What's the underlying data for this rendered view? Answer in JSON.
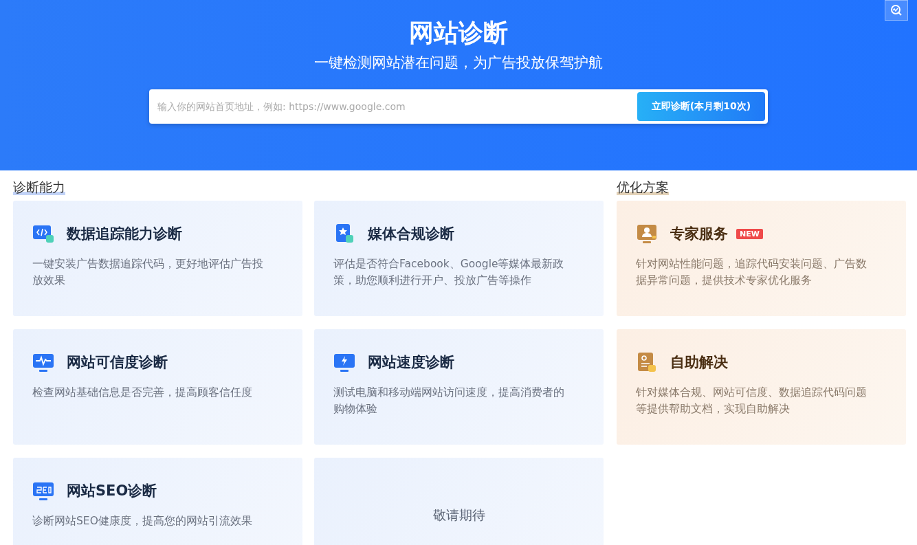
{
  "header": {
    "title": "网站诊断",
    "subtitle": "一键检测网站潜在问题，为广告投放保驾护航"
  },
  "search": {
    "placeholder": "输入你的网站首页地址，例如: https://www.google.com",
    "button": "立即诊断(本月剩10次)"
  },
  "diagnosis": {
    "heading": "诊断能力",
    "cards": [
      {
        "kind": "feature",
        "title": "数据追踪能力诊断",
        "description": "一键安装广告数据追踪代码，更好地评估广告投放效果"
      },
      {
        "kind": "feature",
        "title": "媒体合规诊断",
        "description": "评估是否符合Facebook、Google等媒体最新政策，助您顺利进行开户、投放广告等操作"
      },
      {
        "kind": "feature",
        "title": "网站可信度诊断",
        "description": "检查网站基础信息是否完善，提高顾客信任度"
      },
      {
        "kind": "feature",
        "title": "网站速度诊断",
        "description": "测试电脑和移动端网站访问速度，提高消费者的购物体验"
      },
      {
        "kind": "feature",
        "title": "网站SEO诊断",
        "description": "诊断网站SEO健康度，提高您的网站引流效果"
      },
      {
        "kind": "placeholder",
        "title": "敬请期待"
      }
    ]
  },
  "optimization": {
    "heading": "优化方案",
    "cards": [
      {
        "title": "专家服务",
        "badge": "NEW",
        "description": "针对网站性能问题，追踪代码安装问题、广告数据异常问题，提供技术专家优化服务"
      },
      {
        "title": "自助解决",
        "description": "针对媒体合规、网站可信度、数据追踪代码问题等提供帮助文档，实现自助解决"
      }
    ]
  }
}
